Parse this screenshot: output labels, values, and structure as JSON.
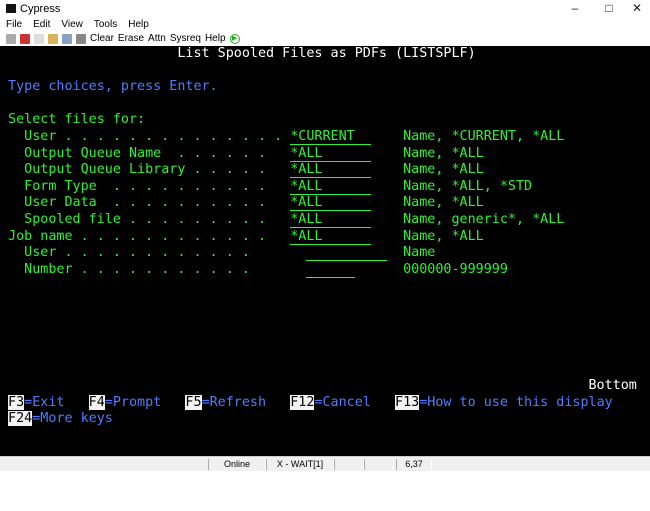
{
  "window": {
    "title": "Cypress",
    "minimize": "–",
    "maximize": "□",
    "close": "✕"
  },
  "menu": [
    "File",
    "Edit",
    "View",
    "Tools",
    "Help"
  ],
  "toolbar": {
    "buttons": [
      "Clear",
      "Erase",
      "Attn",
      "Sysreq",
      "Help"
    ]
  },
  "screen": {
    "title": "List Spooled Files as PDFs (LISTSPLF)",
    "instruction": "Type choices, press Enter.",
    "section": "Select files for:",
    "fields": [
      {
        "label": "User . . . . . . . . . . . . . .",
        "value": "*CURRENT",
        "hint": "Name, *CURRENT, *ALL"
      },
      {
        "label": "Output Queue Name  . . . . . .",
        "value": "*ALL",
        "hint": "Name, *ALL"
      },
      {
        "label": "Output Queue Library . . . . .",
        "value": "*ALL",
        "hint": "Name, *ALL"
      },
      {
        "label": "Form Type  . . . . . . . . . .",
        "value": "*ALL",
        "hint": "Name, *ALL, *STD"
      },
      {
        "label": "User Data  . . . . . . . . . .",
        "value": "*ALL",
        "hint": "Name, *ALL"
      },
      {
        "label": "Spooled file . . . . . . . . .",
        "value": "*ALL",
        "hint": "Name, generic*, *ALL"
      },
      {
        "label": "Job name . . . . . . . . . . . .",
        "value": "*ALL",
        "hint": "Name, *ALL"
      },
      {
        "label": "User . . . . . . . . . . . .",
        "value": "",
        "hint": "Name"
      },
      {
        "label": "Number . . . . . . . . . . .",
        "value": "",
        "hint": "000000-999999"
      }
    ],
    "more": "Bottom",
    "fkeys": [
      {
        "key": "F3",
        "label": "=Exit"
      },
      {
        "key": "F4",
        "label": "=Prompt"
      },
      {
        "key": "F5",
        "label": "=Refresh"
      },
      {
        "key": "F12",
        "label": "=Cancel"
      },
      {
        "key": "F13",
        "label": "=How to use this display"
      },
      {
        "key": "F24",
        "label": "=More keys"
      }
    ]
  },
  "status": {
    "mode": "Online",
    "state": "X - WAIT[1]",
    "cursor": "6,37"
  }
}
